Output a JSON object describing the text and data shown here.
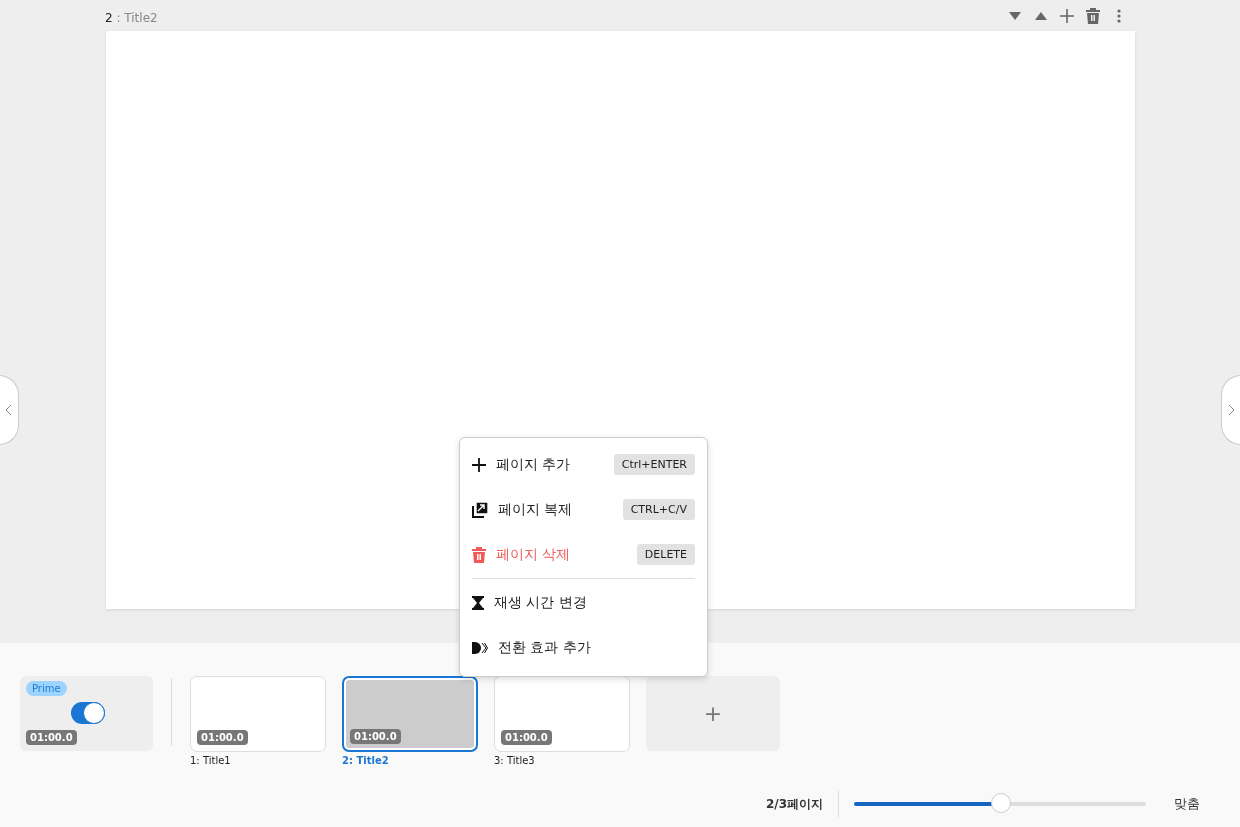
{
  "page_header": {
    "number": "2",
    "title": ": Title2"
  },
  "toolbar": [
    {
      "kind": "down"
    },
    {
      "kind": "up"
    },
    {
      "kind": "add"
    },
    {
      "kind": "delete"
    },
    {
      "kind": "more"
    }
  ],
  "context_menu": [
    {
      "kind": "add",
      "label": "페이지 추가",
      "shortcut": "Ctrl+ENTER",
      "danger": false,
      "divider_before": false
    },
    {
      "kind": "duplicate",
      "label": "페이지 복제",
      "shortcut": "CTRL+C/V",
      "danger": false,
      "divider_before": false
    },
    {
      "kind": "delete",
      "label": "페이지 삭제",
      "shortcut": "DELETE",
      "danger": true,
      "divider_before": false
    },
    {
      "kind": "duration",
      "label": "재생 시간 변경",
      "danger": false,
      "divider_before": true
    },
    {
      "kind": "transition",
      "label": "전환 효과 추가",
      "danger": false,
      "divider_before": false
    }
  ],
  "prime": {
    "badge": "Prime",
    "on": true,
    "duration": "01:00.0"
  },
  "pages": [
    {
      "label": "1: Title1",
      "duration": "01:00.0",
      "selected": false
    },
    {
      "label": "2: Title2",
      "duration": "01:00.0",
      "selected": true
    },
    {
      "label": "3: Title3",
      "duration": "01:00.0",
      "selected": false
    }
  ],
  "add_page": {
    "label": "+"
  },
  "footer": {
    "page_count": "2/3페이지",
    "zoom": {
      "level": 0.5
    },
    "fit": "맞춤"
  }
}
